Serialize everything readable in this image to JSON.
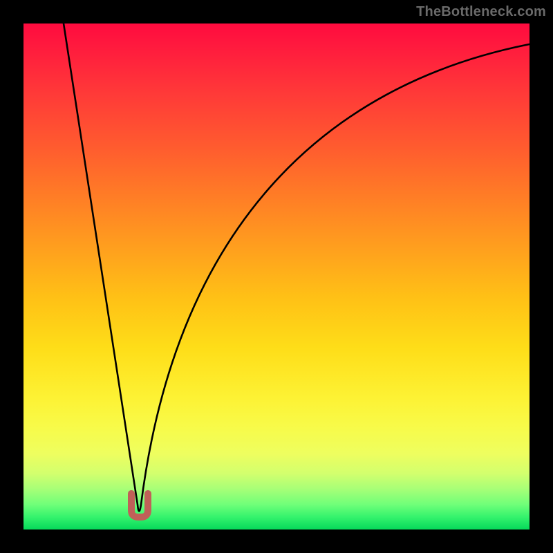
{
  "watermark": "TheBottleneck.com",
  "chart_data": {
    "type": "line",
    "title": "",
    "xlabel": "",
    "ylabel": "",
    "xlim": [
      0,
      100
    ],
    "ylim": [
      0,
      100
    ],
    "grid": false,
    "series": [
      {
        "name": "bottleneck-curve",
        "x": [
          8,
          10,
          12,
          14,
          16,
          18,
          20,
          21,
          22,
          23,
          24,
          25,
          27,
          30,
          35,
          40,
          45,
          50,
          55,
          60,
          65,
          70,
          75,
          80,
          85,
          90,
          95,
          100
        ],
        "values": [
          100,
          85,
          71,
          57,
          43,
          30,
          16,
          9,
          3,
          3,
          9,
          16,
          27,
          40,
          54,
          63,
          70,
          75,
          79,
          83,
          86,
          88,
          90,
          92,
          93.5,
          95,
          96,
          97
        ]
      }
    ],
    "marker": {
      "name": "minimum-marker",
      "shape": "u",
      "color": "#c06058",
      "x_range": [
        21.3,
        23.8
      ],
      "y_range": [
        2.5,
        7.5
      ]
    },
    "gradient_stops": [
      {
        "pos": 0,
        "color": "#ff0b3f"
      },
      {
        "pos": 50,
        "color": "#ffb01a"
      },
      {
        "pos": 80,
        "color": "#f7fb4a"
      },
      {
        "pos": 100,
        "color": "#06d95a"
      }
    ]
  }
}
